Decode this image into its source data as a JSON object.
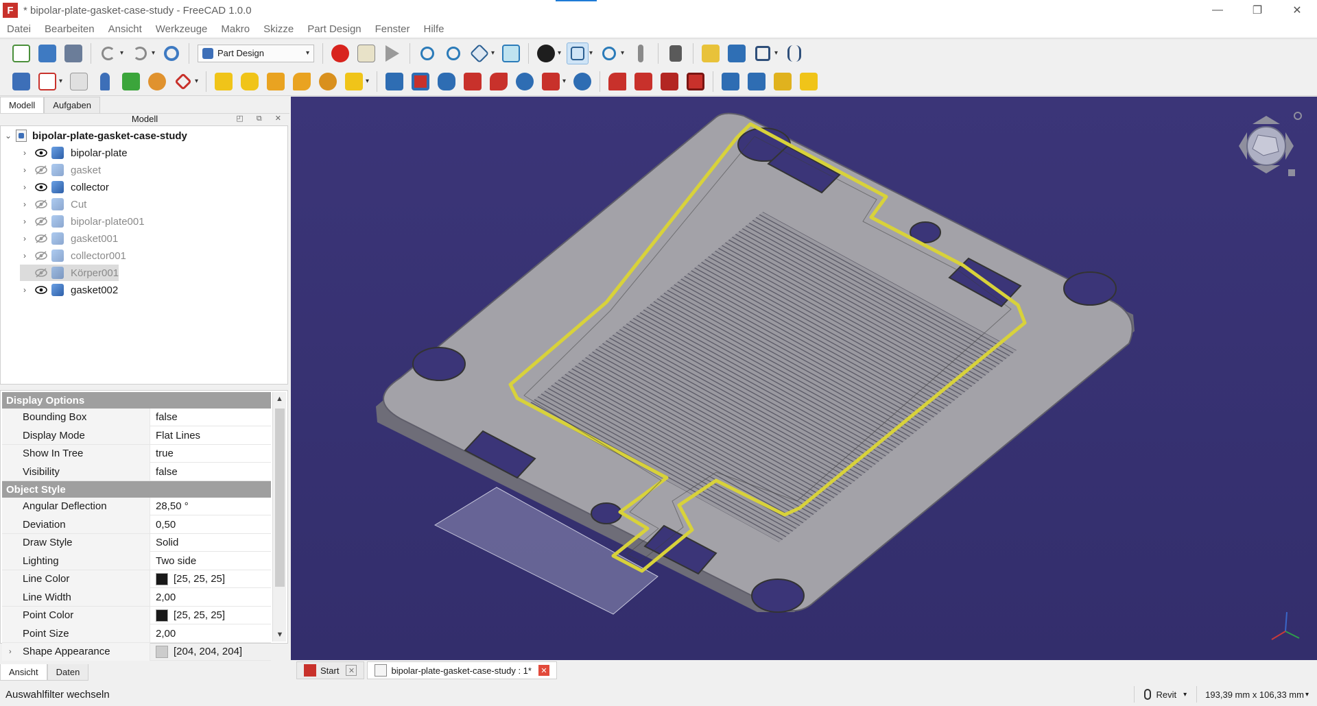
{
  "window": {
    "title": "* bipolar-plate-gasket-case-study - FreeCAD 1.0.0",
    "app_icon": "F",
    "controls": {
      "minimize": "—",
      "maximize": "❐",
      "close": "✕"
    }
  },
  "menu": [
    "Datei",
    "Bearbeiten",
    "Ansicht",
    "Werkzeuge",
    "Makro",
    "Skizze",
    "Part Design",
    "Fenster",
    "Hilfe"
  ],
  "toolbar": {
    "workbench": "Part Design",
    "dropdown_arrow": "▾"
  },
  "left_panel": {
    "tabs": [
      "Modell",
      "Aufgaben"
    ],
    "header": "Modell",
    "header_buttons": "◰ ⧉ ✕",
    "tree": {
      "document": "bipolar-plate-gasket-case-study",
      "document_arrow": "⌄",
      "items": [
        {
          "label": "bipolar-plate",
          "visible": true,
          "expandable": true
        },
        {
          "label": "gasket",
          "visible": false,
          "expandable": true
        },
        {
          "label": "collector",
          "visible": true,
          "expandable": true
        },
        {
          "label": "Cut",
          "visible": false,
          "expandable": true
        },
        {
          "label": "bipolar-plate001",
          "visible": false,
          "expandable": true
        },
        {
          "label": "gasket001",
          "visible": false,
          "expandable": true
        },
        {
          "label": "collector001",
          "visible": false,
          "expandable": true
        },
        {
          "label": "Körper001",
          "visible": false,
          "expandable": false,
          "selected": true
        },
        {
          "label": "gasket002",
          "visible": true,
          "expandable": true
        }
      ],
      "expand_glyph": "›"
    },
    "properties": {
      "groups": [
        {
          "name": "Display Options",
          "rows": [
            {
              "name": "Bounding Box",
              "value": "false"
            },
            {
              "name": "Display Mode",
              "value": "Flat Lines"
            },
            {
              "name": "Show In Tree",
              "value": "true"
            },
            {
              "name": "Visibility",
              "value": "false"
            }
          ]
        },
        {
          "name": "Object Style",
          "rows": [
            {
              "name": "Angular Deflection",
              "value": "28,50 °"
            },
            {
              "name": "Deviation",
              "value": "0,50"
            },
            {
              "name": "Draw Style",
              "value": "Solid"
            },
            {
              "name": "Lighting",
              "value": "Two side"
            },
            {
              "name": "Line Color",
              "value": "[25, 25, 25]",
              "swatch": "#191919"
            },
            {
              "name": "Line Width",
              "value": "2,00"
            },
            {
              "name": "Point Color",
              "value": "[25, 25, 25]",
              "swatch": "#191919"
            },
            {
              "name": "Point Size",
              "value": "2,00"
            },
            {
              "name": "Shape Appearance",
              "value": "[204, 204, 204]",
              "swatch": "#cccccc",
              "expandable": true
            }
          ]
        }
      ],
      "scroll_up": "▲",
      "scroll_down": "▼"
    },
    "bottom_tabs": [
      "Ansicht",
      "Daten"
    ]
  },
  "viewport": {
    "background_top": "#3b3578",
    "background_bottom": "#332e6c",
    "plate_color": "#9e9da3",
    "gasket_color": "#d8d23a"
  },
  "doc_tabs": [
    {
      "label": "Start",
      "icon": "freecad-icon",
      "active": false
    },
    {
      "label": "bipolar-plate-gasket-case-study : 1*",
      "icon": "document-icon",
      "active": true
    }
  ],
  "doc_tab_close": "✕",
  "statusbar": {
    "message": "Auswahlfilter wechseln",
    "nav_style": "Revit",
    "dimensions": "193,39 mm x 106,33 mm"
  }
}
